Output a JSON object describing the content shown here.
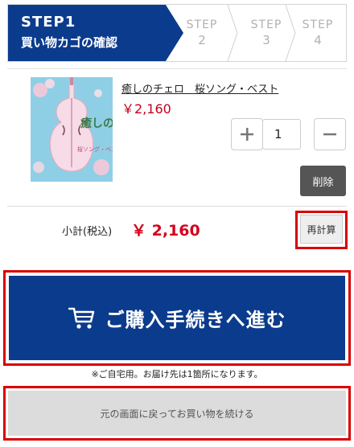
{
  "steps": {
    "active": {
      "label": "STEP1",
      "title": "買い物カゴの確認"
    },
    "others": [
      {
        "label": "STEP",
        "num": "2"
      },
      {
        "label": "STEP",
        "num": "3"
      },
      {
        "label": "STEP",
        "num": "4"
      }
    ]
  },
  "item": {
    "name": "癒しのチェロ　桜ソング・ベスト",
    "price": "￥2,160",
    "quantity": "1",
    "delete_label": "削除",
    "cover": {
      "title_line1": "癒しのチェロ",
      "title_line2": "桜ソング・ベスト",
      "accent": "#8fcfe6"
    }
  },
  "subtotal": {
    "label": "小計(税込)",
    "value": "￥ 2,160",
    "recalc_label": "再計算"
  },
  "checkout": {
    "label": "ご購入手続きへ進む",
    "note": "※ご自宅用。お届け先は1箇所になります。"
  },
  "continue": {
    "label": "元の画面に戻ってお買い物を続ける"
  },
  "colors": {
    "brand": "#0b3b8c",
    "price": "#c4001c",
    "highlight": "#d90000"
  }
}
